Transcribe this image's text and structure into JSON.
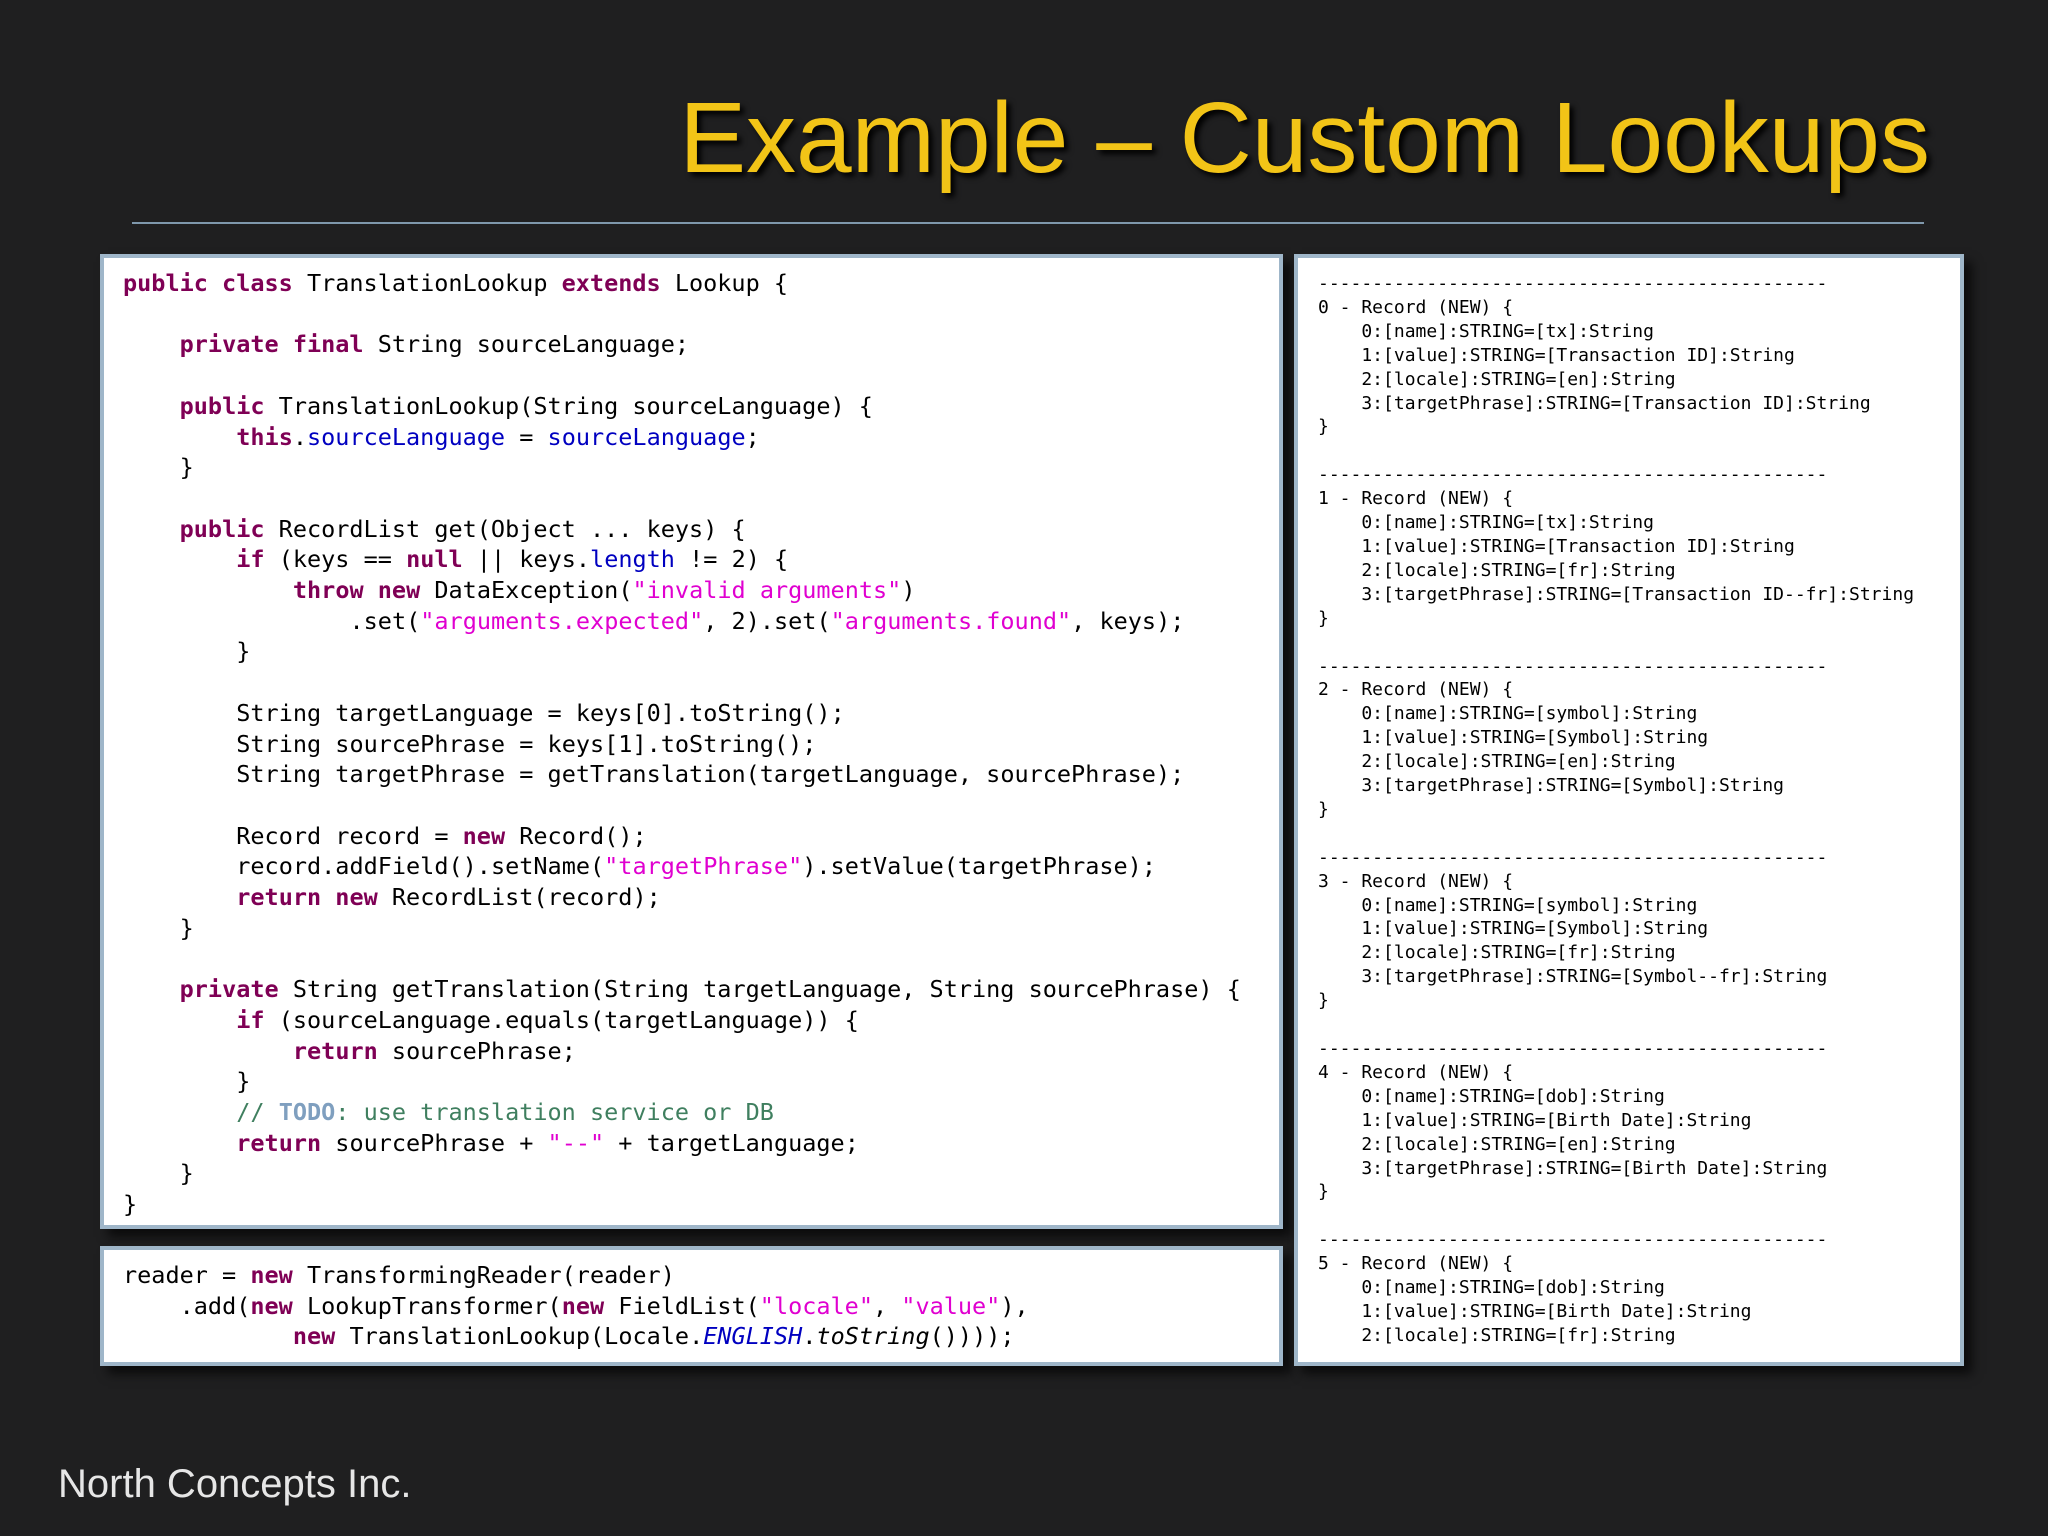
{
  "slide": {
    "title": "Example – Custom Lookups",
    "footer": "North Concepts Inc."
  },
  "code_panel": {
    "colors": {
      "keyword": "#7f0055",
      "string": "#e000d0",
      "field": "#0000c0",
      "comment": "#3f7f5f",
      "todo": "#7f9fbf"
    },
    "lines": [
      "public class TranslationLookup extends Lookup {",
      "",
      "    private final String sourceLanguage;",
      "",
      "    public TranslationLookup(String sourceLanguage) {",
      "        this.sourceLanguage = sourceLanguage;",
      "    }",
      "",
      "    public RecordList get(Object ... keys) {",
      "        if (keys == null || keys.length != 2) {",
      "            throw new DataException(\"invalid arguments\")",
      "                .set(\"arguments.expected\", 2).set(\"arguments.found\", keys);",
      "        }",
      "",
      "        String targetLanguage = keys[0].toString();",
      "        String sourcePhrase = keys[1].toString();",
      "        String targetPhrase = getTranslation(targetLanguage, sourcePhrase);",
      "",
      "        Record record = new Record();",
      "        record.addField().setName(\"targetPhrase\").setValue(targetPhrase);",
      "        return new RecordList(record);",
      "    }",
      "",
      "    private String getTranslation(String targetLanguage, String sourcePhrase) {",
      "        if (sourceLanguage.equals(targetLanguage)) {",
      "            return sourcePhrase;",
      "        }",
      "        // TODO: use translation service or DB",
      "        return sourcePhrase + \"--\" + targetLanguage;",
      "    }",
      "}"
    ]
  },
  "usage_panel": {
    "lines": [
      "reader = new TransformingReader(reader)",
      "    .add(new LookupTransformer(new FieldList(\"locale\", \"value\"),",
      "            new TranslationLookup(Locale.ENGLISH.toString())));"
    ]
  },
  "output_panel": {
    "lines": [
      "-----------------------------------------------",
      "0 - Record (NEW) {",
      "    0:[name]:STRING=[tx]:String",
      "    1:[value]:STRING=[Transaction ID]:String",
      "    2:[locale]:STRING=[en]:String",
      "    3:[targetPhrase]:STRING=[Transaction ID]:String",
      "}",
      "",
      "-----------------------------------------------",
      "1 - Record (NEW) {",
      "    0:[name]:STRING=[tx]:String",
      "    1:[value]:STRING=[Transaction ID]:String",
      "    2:[locale]:STRING=[fr]:String",
      "    3:[targetPhrase]:STRING=[Transaction ID--fr]:String",
      "}",
      "",
      "-----------------------------------------------",
      "2 - Record (NEW) {",
      "    0:[name]:STRING=[symbol]:String",
      "    1:[value]:STRING=[Symbol]:String",
      "    2:[locale]:STRING=[en]:String",
      "    3:[targetPhrase]:STRING=[Symbol]:String",
      "}",
      "",
      "-----------------------------------------------",
      "3 - Record (NEW) {",
      "    0:[name]:STRING=[symbol]:String",
      "    1:[value]:STRING=[Symbol]:String",
      "    2:[locale]:STRING=[fr]:String",
      "    3:[targetPhrase]:STRING=[Symbol--fr]:String",
      "}",
      "",
      "-----------------------------------------------",
      "4 - Record (NEW) {",
      "    0:[name]:STRING=[dob]:String",
      "    1:[value]:STRING=[Birth Date]:String",
      "    2:[locale]:STRING=[en]:String",
      "    3:[targetPhrase]:STRING=[Birth Date]:String",
      "}",
      "",
      "-----------------------------------------------",
      "5 - Record (NEW) {",
      "    0:[name]:STRING=[dob]:String",
      "    1:[value]:STRING=[Birth Date]:String",
      "    2:[locale]:STRING=[fr]:String",
      "..."
    ]
  }
}
